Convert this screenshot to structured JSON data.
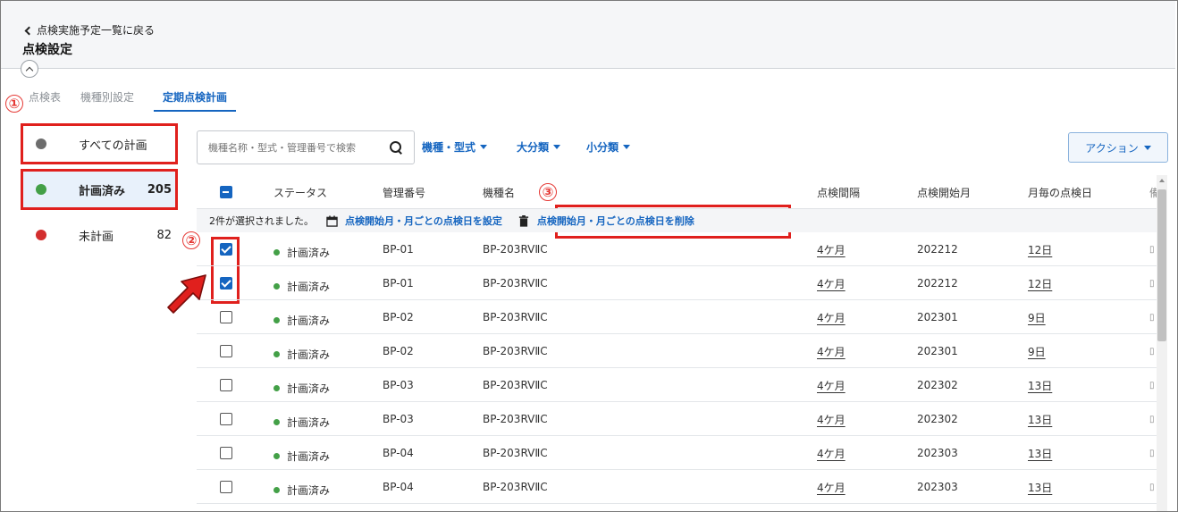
{
  "header": {
    "back_label": "点検実施予定一覧に戻る",
    "title": "点検設定"
  },
  "tabs": [
    {
      "label": "点検表",
      "active": false
    },
    {
      "label": "機種別設定",
      "active": false
    },
    {
      "label": "定期点検計画",
      "active": true
    }
  ],
  "annotations": [
    "①",
    "②",
    "③"
  ],
  "sidebar": {
    "items": [
      {
        "label": "すべての計画",
        "count": "",
        "dot_color": "#6d6d6d"
      },
      {
        "label": "計画済み",
        "count": "205",
        "dot_color": "#43a047"
      },
      {
        "label": "未計画",
        "count": "82",
        "dot_color": "#d32f2f"
      }
    ]
  },
  "toolbar": {
    "search_placeholder": "機種名称・型式・管理番号で検索",
    "filters": [
      "機種・型式",
      "大分類",
      "小分類"
    ],
    "action_label": "アクション"
  },
  "table": {
    "columns": [
      "ステータス",
      "管理番号",
      "機種名",
      "点検間隔",
      "点検開始月",
      "月毎の点検日",
      "備"
    ],
    "bulk": {
      "selected_text": "2件が選択されました。",
      "set_label": "点検開始月・月ごとの点検日を設定",
      "delete_label": "点検開始月・月ごとの点検日を削除"
    },
    "rows": [
      {
        "checked": true,
        "status": "計画済み",
        "code": "BP-01",
        "model": "BP-203RVⅡC",
        "interval": "4ケ月",
        "start": "202212",
        "day": "12日"
      },
      {
        "checked": true,
        "status": "計画済み",
        "code": "BP-01",
        "model": "BP-203RVⅡC",
        "interval": "4ケ月",
        "start": "202212",
        "day": "12日"
      },
      {
        "checked": false,
        "status": "計画済み",
        "code": "BP-02",
        "model": "BP-203RVⅡC",
        "interval": "4ケ月",
        "start": "202301",
        "day": "9日"
      },
      {
        "checked": false,
        "status": "計画済み",
        "code": "BP-02",
        "model": "BP-203RVⅡC",
        "interval": "4ケ月",
        "start": "202301",
        "day": "9日"
      },
      {
        "checked": false,
        "status": "計画済み",
        "code": "BP-03",
        "model": "BP-203RVⅡC",
        "interval": "4ケ月",
        "start": "202302",
        "day": "13日"
      },
      {
        "checked": false,
        "status": "計画済み",
        "code": "BP-03",
        "model": "BP-203RVⅡC",
        "interval": "4ケ月",
        "start": "202302",
        "day": "13日"
      },
      {
        "checked": false,
        "status": "計画済み",
        "code": "BP-04",
        "model": "BP-203RVⅡC",
        "interval": "4ケ月",
        "start": "202303",
        "day": "13日"
      },
      {
        "checked": false,
        "status": "計画済み",
        "code": "BP-04",
        "model": "BP-203RVⅡC",
        "interval": "4ケ月",
        "start": "202303",
        "day": "13日"
      }
    ]
  },
  "colors": {
    "accent": "#1565c0",
    "annotation_red": "#e0201d",
    "status_green": "#43a047"
  }
}
